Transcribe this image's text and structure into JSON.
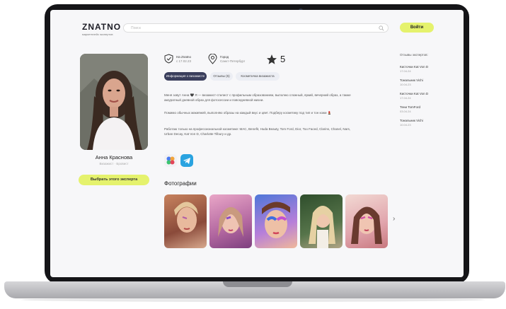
{
  "header": {
    "logo_title": "ZNATNO",
    "logo_subtitle": "маркетплейс экспертов",
    "search_placeholder": "Поиск",
    "login_label": "Войти"
  },
  "profile": {
    "name": "Анна Краснова",
    "role": "Визажист · Бровист",
    "choose_button": "Выбрать этого эксперта"
  },
  "stats": {
    "znatno_title": "На Znatno",
    "znatno_since": "с 17.02.23",
    "city_title": "Город",
    "city_value": "Санкт-Петербург",
    "rating": "5"
  },
  "tabs": [
    {
      "label": "Информация о визажисте",
      "active": true
    },
    {
      "label": "Отзывы (5)",
      "active": false
    },
    {
      "label": "Косметичка визажиста",
      "active": false
    }
  ],
  "about": [
    "Меня зовут Анна 🖤 Я — визажист-стилист с профильным образованием, выполню сложный, яркий, вечерний образ, а также аккуратный дневной образ для фотосессии и повседневной жизни.",
    "Помимо обычных макияжей, выполняю образы на каждый вкус и цвет. Подберу косметику под тип и тон кожи 💄",
    "Работаю только на профессиональной косметике: MAC, Benefit, Huda Beauty, Tom Ford, Dior, Too Faced, Clarins, Chanel, Nars, Urban Decay, Kat Von D, Charlotte Tilbury и др."
  ],
  "photos_title": "Фотографии",
  "sidebar": {
    "heading": "Отзывы экспертов:",
    "items": [
      {
        "name": "Кисточки Kat Von D",
        "date": "17.04.24"
      },
      {
        "name": "Тональник Vichi",
        "date": "10.04.23"
      },
      {
        "name": "Кисточки Kat Von D",
        "date": "17.04.24"
      },
      {
        "name": "Тени TomFord",
        "date": "03.04.24"
      },
      {
        "name": "Тональник Vichi",
        "date": "10.04.23"
      }
    ]
  },
  "colors": {
    "accent": "#e5f26d",
    "tab_active": "#3a3e5c",
    "telegram": "#2aa3e0"
  }
}
